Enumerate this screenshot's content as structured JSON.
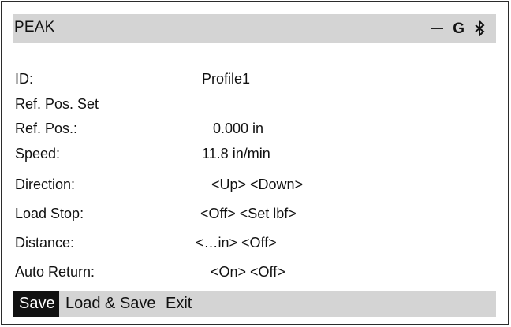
{
  "header": {
    "title": "PEAK",
    "status_icons": [
      "minus-icon",
      "g-indicator",
      "bluetooth-icon"
    ],
    "g_label": "G"
  },
  "fields": [
    {
      "label": "ID:",
      "value": "Profile1"
    },
    {
      "label": "Ref. Pos. Set",
      "value": ""
    },
    {
      "label": "Ref. Pos.:",
      "value": "0.000 in"
    },
    {
      "label": "Speed:",
      "value": "11.8 in/min"
    },
    {
      "label": "Direction:",
      "value": "<Up> <Down>"
    },
    {
      "label": "Load Stop:",
      "value": "<Off> <Set lbf>"
    },
    {
      "label": "Distance:",
      "value": "<…in> <Off>"
    },
    {
      "label": "Auto Return:",
      "value": "<On> <Off>"
    }
  ],
  "footer": {
    "save_label": "Save",
    "load_save_label": "Load & Save",
    "exit_label": "Exit"
  },
  "colors": {
    "bar_background": "#d4d4d4",
    "selected_background": "#111111",
    "selected_text": "#ffffff"
  }
}
